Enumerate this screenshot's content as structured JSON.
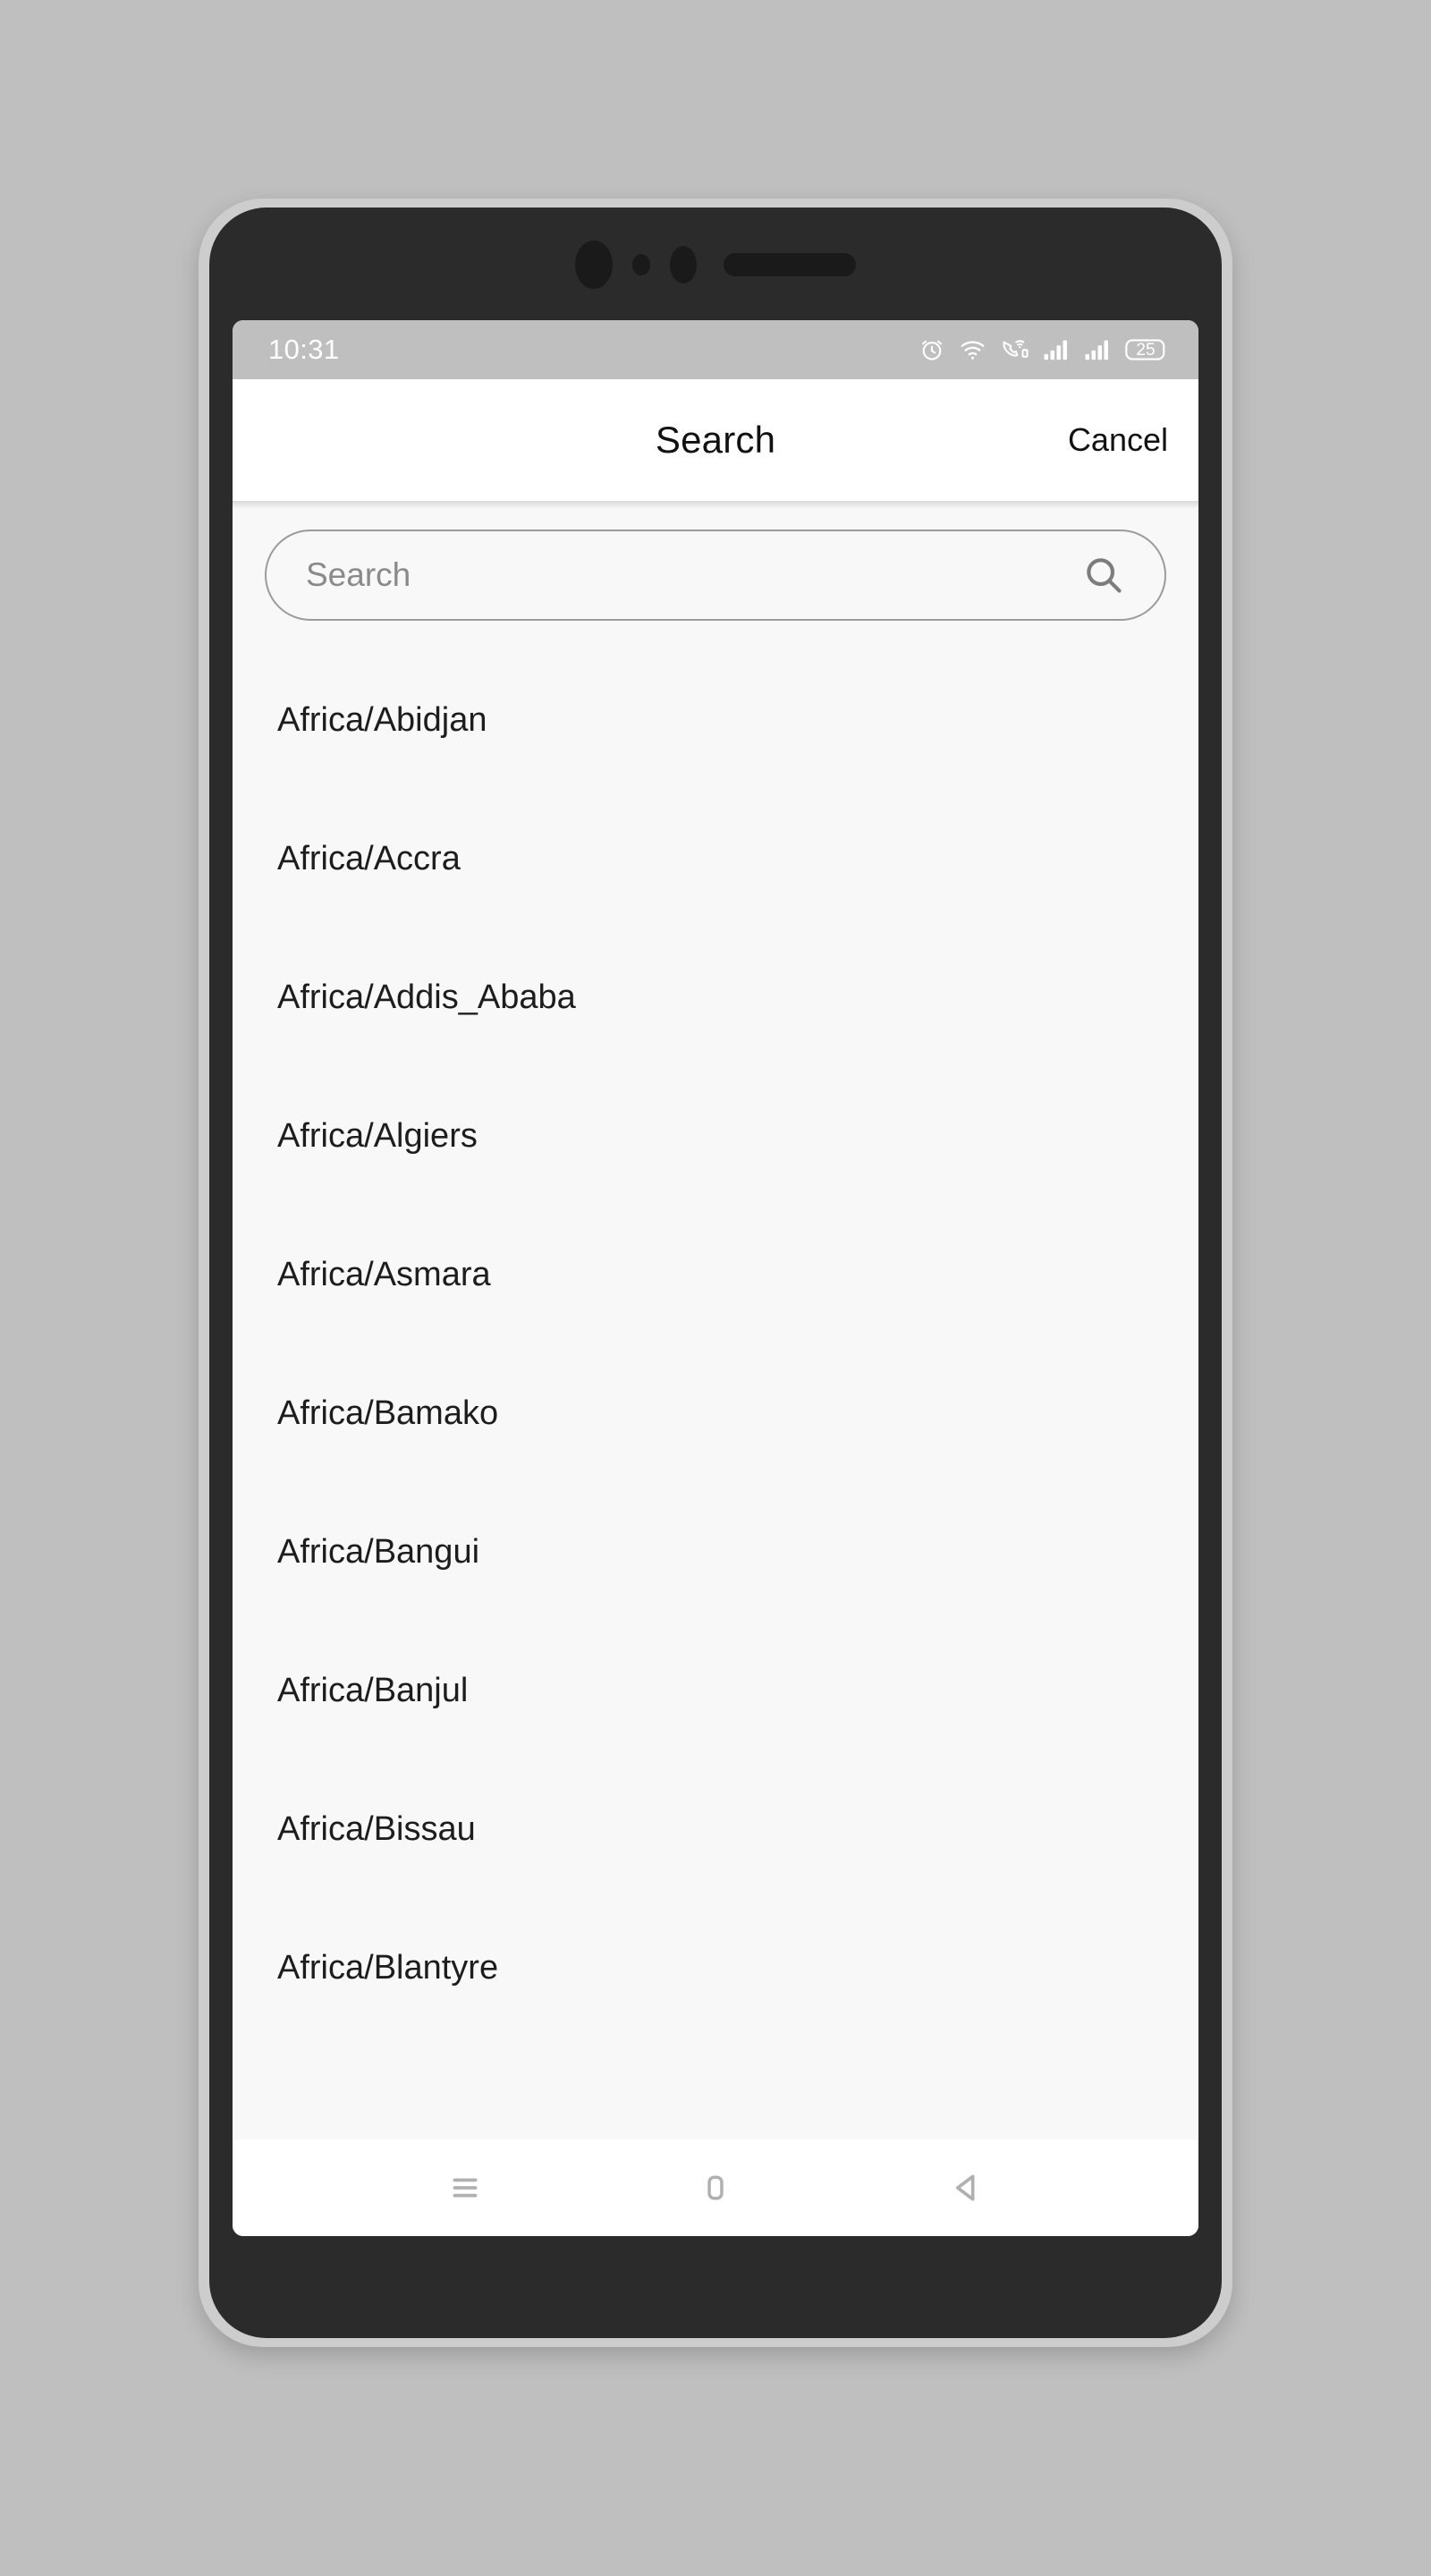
{
  "page": {
    "background_color": "#bfbfbf",
    "device_frame_color": "#cdcdcd",
    "device_bezel_color": "#2b2b2b",
    "screen_color": "#fafafa"
  },
  "status_bar": {
    "time": "10:31",
    "background_color": "#bfbfbf",
    "foreground_color": "#ffffff",
    "icons": [
      {
        "name": "alarm-clock-icon"
      },
      {
        "name": "wifi-icon"
      },
      {
        "name": "wifi-calling-icon"
      },
      {
        "name": "signal-bars-sim1-icon"
      },
      {
        "name": "signal-bars-sim2-icon"
      },
      {
        "name": "battery-icon"
      }
    ],
    "battery_level": "25"
  },
  "header": {
    "title": "Search",
    "cancel_label": "Cancel",
    "background_color": "#ffffff",
    "text_color": "#111111"
  },
  "search": {
    "value": "",
    "placeholder": "Search",
    "icon": "search-icon",
    "border_color": "#9b9b9b",
    "placeholder_color": "#8a8a8a"
  },
  "list": {
    "background_color": "#f8f8f8",
    "text_color": "#1d1d1d",
    "items": [
      {
        "label": "Africa/Abidjan"
      },
      {
        "label": "Africa/Accra"
      },
      {
        "label": "Africa/Addis_Ababa"
      },
      {
        "label": "Africa/Algiers"
      },
      {
        "label": "Africa/Asmara"
      },
      {
        "label": "Africa/Bamako"
      },
      {
        "label": "Africa/Bangui"
      },
      {
        "label": "Africa/Banjul"
      },
      {
        "label": "Africa/Bissau"
      },
      {
        "label": "Africa/Blantyre"
      }
    ]
  },
  "nav_bar": {
    "background_color": "#ffffff",
    "icon_color": "#b0b0b0",
    "buttons": [
      {
        "name": "recents-button",
        "icon": "menu-lines-icon"
      },
      {
        "name": "home-button",
        "icon": "rounded-square-icon"
      },
      {
        "name": "back-button",
        "icon": "triangle-left-icon"
      }
    ]
  }
}
